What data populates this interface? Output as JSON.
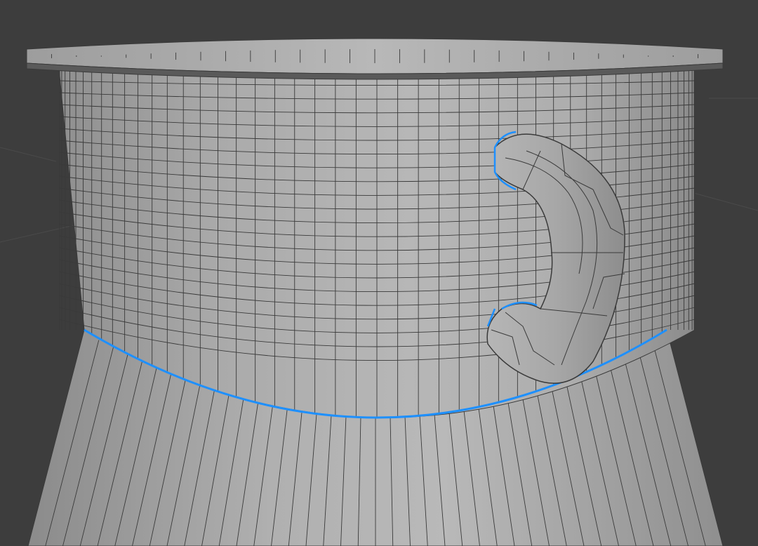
{
  "viewport": {
    "colors": {
      "background": "#3d3d3d",
      "grid": "#4a4a4a",
      "mesh_fill_light": "#b6b6b6",
      "mesh_fill_mid": "#a7a7a7",
      "mesh_fill_dark": "#8d8d8d",
      "wire": "#3a3a3a",
      "selection": "#1e90ff"
    }
  }
}
